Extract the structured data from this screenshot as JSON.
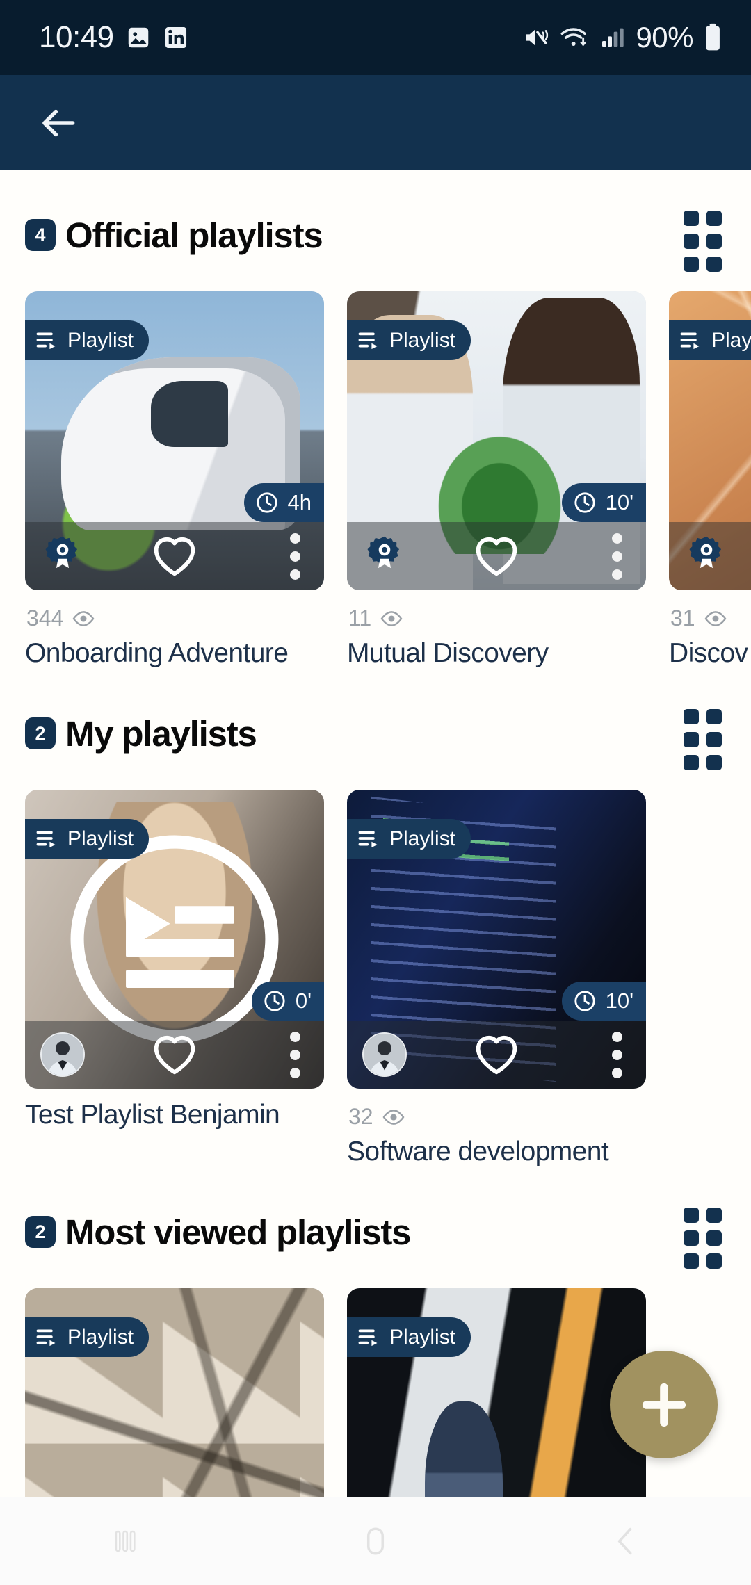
{
  "status_bar": {
    "time": "10:49",
    "battery_percent": "90%",
    "icons": [
      "photos-icon",
      "linkedin-icon",
      "mute-icon",
      "wifi-icon",
      "signal-icon",
      "battery-icon"
    ]
  },
  "header": {
    "back_label": "back-arrow"
  },
  "sections": [
    {
      "count": "4",
      "title": "Official playlists",
      "grid_toggle_label": "grid-view-toggle",
      "cards": [
        {
          "tag": "Playlist",
          "duration": "4h",
          "views": "344",
          "title": "Onboarding Adventure",
          "badge": "official-award-badge",
          "art": "art-train",
          "has_overlay": false,
          "has_views": true,
          "has_avatar": false
        },
        {
          "tag": "Playlist",
          "duration": "10'",
          "views": "11",
          "title": "Mutual Discovery",
          "badge": "official-award-badge",
          "art": "art-office",
          "has_overlay": false,
          "has_views": true,
          "has_avatar": false
        },
        {
          "tag": "Playli",
          "duration": "",
          "views": "31",
          "title": "Discov",
          "badge": "official-award-badge",
          "art": "art-orange",
          "has_overlay": false,
          "has_views": true,
          "has_avatar": false
        }
      ]
    },
    {
      "count": "2",
      "title": "My playlists",
      "grid_toggle_label": "grid-view-toggle",
      "cards": [
        {
          "tag": "Playlist",
          "duration": "0'",
          "views": "",
          "title": "Test Playlist Benjamin",
          "badge": "",
          "art": "art-woman",
          "has_overlay": true,
          "has_views": false,
          "has_avatar": true
        },
        {
          "tag": "Playlist",
          "duration": "10'",
          "views": "32",
          "title": "Software development",
          "badge": "",
          "art": "art-code",
          "has_overlay": false,
          "has_views": true,
          "has_avatar": true
        }
      ]
    },
    {
      "count": "2",
      "title": "Most viewed playlists",
      "grid_toggle_label": "grid-view-toggle",
      "cards": [
        {
          "tag": "Playlist",
          "duration": "",
          "views": "",
          "title": "",
          "badge": "",
          "art": "art-wood",
          "has_overlay": false,
          "has_views": false,
          "has_avatar": false
        },
        {
          "tag": "Playlist",
          "duration": "",
          "views": "",
          "title": "",
          "badge": "",
          "art": "art-warehouse",
          "has_overlay": false,
          "has_views": false,
          "has_avatar": false
        }
      ]
    }
  ],
  "fab": {
    "label": "add-playlist",
    "symbol": "+",
    "color": "#a19260"
  },
  "nav_bar": {
    "recents_label": "recents-button",
    "home_label": "home-button",
    "back_label": "back-button"
  },
  "colors": {
    "status_bar": "#081c2e",
    "header": "#12314e",
    "badge": "#13314e",
    "tag": "#183a5a",
    "duration": "#1b4066",
    "title_text": "#1d3049",
    "meta_text": "#9aa0a6",
    "fab": "#a19260"
  }
}
